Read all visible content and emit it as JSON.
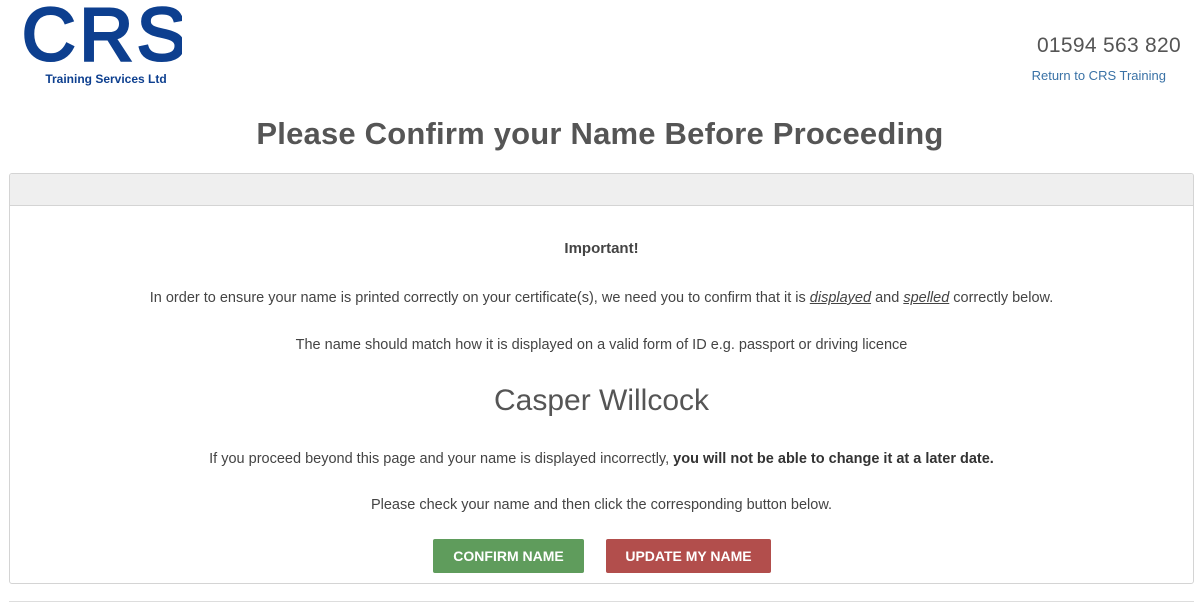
{
  "header": {
    "logo_text": "CRS",
    "logo_subtitle": "Training Services Ltd",
    "phone": "01594 563 820",
    "return_link": "Return to CRS Training"
  },
  "page_title": "Please Confirm your Name Before Proceeding",
  "panel": {
    "important_heading": "Important!",
    "line1_before": "In order to ensure your name is printed correctly on your certificate(s), we need you to confirm that it is ",
    "line1_em1": "displayed",
    "line1_mid": " and ",
    "line1_em2": "spelled",
    "line1_after": " correctly below.",
    "line2": "The name should match how it is displayed on a valid form of ID e.g. passport or driving licence",
    "name": "Casper Willcock",
    "warning_before": "If you proceed beyond this page and your name is displayed incorrectly, ",
    "warning_bold": "you will not be able to change it at a later date.",
    "check_text": "Please check your name and then click the corresponding button below.",
    "confirm_button": "CONFIRM NAME",
    "update_button": "UPDATE MY NAME"
  },
  "colors": {
    "brand_blue": "#0d3f8f",
    "link_blue": "#3a72a6",
    "confirm_green": "#5f9c5c",
    "update_red": "#b24e4c"
  }
}
